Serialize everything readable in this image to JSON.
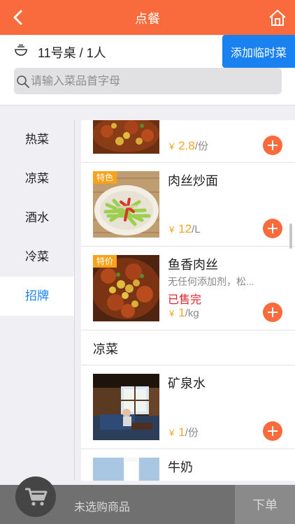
{
  "header": {
    "title": "点餐",
    "back_icon": "chevron-left-icon",
    "home_icon": "home-icon"
  },
  "table": {
    "info": "11号桌 / 1人",
    "icon": "bowl-icon",
    "add_temp_label": "添加临时菜"
  },
  "search": {
    "placeholder": "请输入菜品首字母",
    "value": ""
  },
  "categories": [
    {
      "label": "热菜"
    },
    {
      "label": "凉菜"
    },
    {
      "label": "酒水"
    },
    {
      "label": "冷菜"
    },
    {
      "label": "招牌",
      "active": true
    }
  ],
  "items": [
    {
      "name": "",
      "currency": "¥",
      "price": "2.8",
      "unit": "/份"
    },
    {
      "name": "肉丝炒面",
      "badge": "特色",
      "currency": "¥",
      "price": "12",
      "unit": "/L"
    },
    {
      "name": "鱼香肉丝",
      "badge": "特价",
      "desc": "无任何添加剂，松...",
      "status": "已售完",
      "currency": "¥",
      "price": "1",
      "unit": "/kg"
    },
    {
      "name": "矿泉水",
      "currency": "¥",
      "price": "1",
      "unit": "/份"
    },
    {
      "name": "牛奶"
    }
  ],
  "section": {
    "title": "凉菜"
  },
  "footer": {
    "cart_icon": "cart-icon",
    "empty_label": "未选购商品",
    "submit_label": "下单"
  },
  "colors": {
    "accent": "#f96a3c",
    "blue": "#1a82f0",
    "price": "#f5a623",
    "soldout": "#e0232a"
  }
}
